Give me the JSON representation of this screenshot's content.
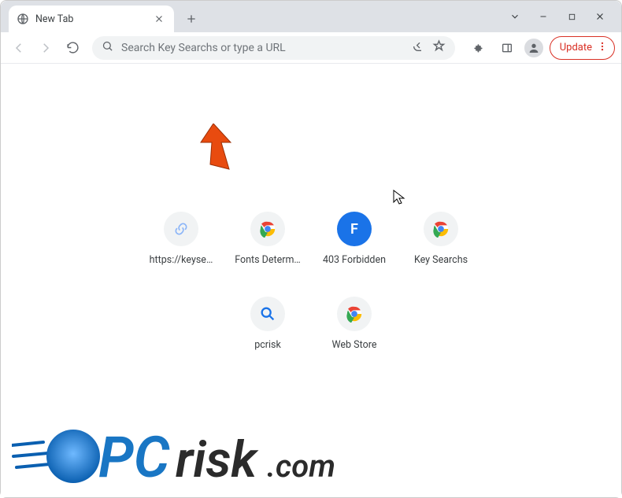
{
  "window": {
    "tab_title": "New Tab",
    "update_label": "Update"
  },
  "omnibox": {
    "placeholder": "Search Key Searchs or type a URL"
  },
  "shortcuts": [
    {
      "label": "https://keyse…",
      "bg": "#f1f3f4",
      "glyph": "link",
      "glyphColor": "#8ab4f8"
    },
    {
      "label": "Fonts Determ…",
      "bg": "#f1f3f4",
      "glyph": "chrome",
      "glyphColor": ""
    },
    {
      "label": "403 Forbidden",
      "bg": "#1a73e8",
      "glyph": "letter",
      "glyphLetter": "F",
      "glyphColor": "#fff"
    },
    {
      "label": "Key Searchs",
      "bg": "#f1f3f4",
      "glyph": "chrome",
      "glyphColor": ""
    },
    {
      "label": "pcrisk",
      "bg": "#f1f3f4",
      "glyph": "search",
      "glyphColor": "#1a73e8"
    },
    {
      "label": "Web Store",
      "bg": "#f1f3f4",
      "glyph": "chrome",
      "glyphColor": ""
    }
  ],
  "watermark": {
    "text_pc": "PC",
    "text_risk": "risk",
    "text_com": ".com"
  }
}
